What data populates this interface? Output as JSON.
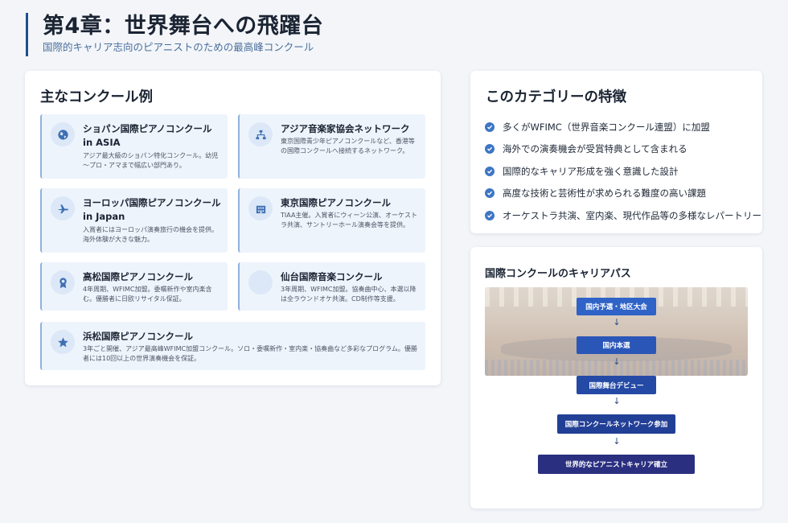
{
  "header": {
    "title": "第4章：世界舞台への飛躍台",
    "subtitle": "国際的キャリア志向のピアニストのための最高峰コンクール"
  },
  "competitions": {
    "title": "主なコンクール例",
    "items": [
      {
        "icon": "globe-icon",
        "name": "ショパン国際ピアノコンクール in ASIA",
        "desc": "アジア最大級のショパン特化コンクール。幼児～プロ・アマまで幅広い部門あり。"
      },
      {
        "icon": "network-icon",
        "name": "アジア音楽家協会ネットワーク",
        "desc": "東京国際青少年ピアノコンクールなど、香港等の国際コンクールへ接続するネットワーク。"
      },
      {
        "icon": "plane-icon",
        "name": "ヨーロッパ国際ピアノコンクール in Japan",
        "desc": "入賞者にはヨーロッパ演奏旅行の機会を提供。海外体験が大きな魅力。"
      },
      {
        "icon": "building-icon",
        "name": "東京国際ピアノコンクール",
        "desc": "TIAA主催。入賞者にウィーン公演、オーケストラ共演、サントリーホール演奏会等を提供。"
      },
      {
        "icon": "award-icon",
        "name": "高松国際ピアノコンクール",
        "desc": "4年周期、WFIMC加盟。委嘱新作や室内楽含む。優勝者に日欧リサイタル保証。"
      },
      {
        "icon": "blank-icon",
        "name": "仙台国際音楽コンクール",
        "desc": "3年周期、WFIMC加盟。協奏曲中心、本選以降は全ラウンドオケ共演。CD制作等支援。"
      },
      {
        "icon": "star-icon",
        "name": "浜松国際ピアノコンクール",
        "desc": "3年ごと開催、アジア最高峰WFIMC加盟コンクール。ソロ・委嘱新作・室内楽・協奏曲など多彩なプログラム。優勝者には10回以上の世界演奏機会を保証。"
      }
    ]
  },
  "features": {
    "title": "このカテゴリーの特徴",
    "items": [
      "多くがWFIMC（世界音楽コンクール連盟）に加盟",
      "海外での演奏機会が受賞特典として含まれる",
      "国際的なキャリア形成を強く意識した設計",
      "高度な技術と芸術性が求められる難度の高い課題",
      "オーケストラ共演、室内楽、現代作品等の多様なレパートリー"
    ]
  },
  "career_path": {
    "title": "国際コンクールのキャリアパス",
    "steps": [
      {
        "label": "国内予選・地区大会",
        "color": "#2f63c7"
      },
      {
        "label": "国内本選",
        "color": "#2a56b8"
      },
      {
        "label": "国際舞台デビュー",
        "color": "#244aa6"
      },
      {
        "label": "国際コンクールネットワーク参加",
        "color": "#223f96"
      },
      {
        "label": "世界的なピアニストキャリア確立",
        "color": "#2a2f80"
      }
    ],
    "arrow": "↓"
  }
}
